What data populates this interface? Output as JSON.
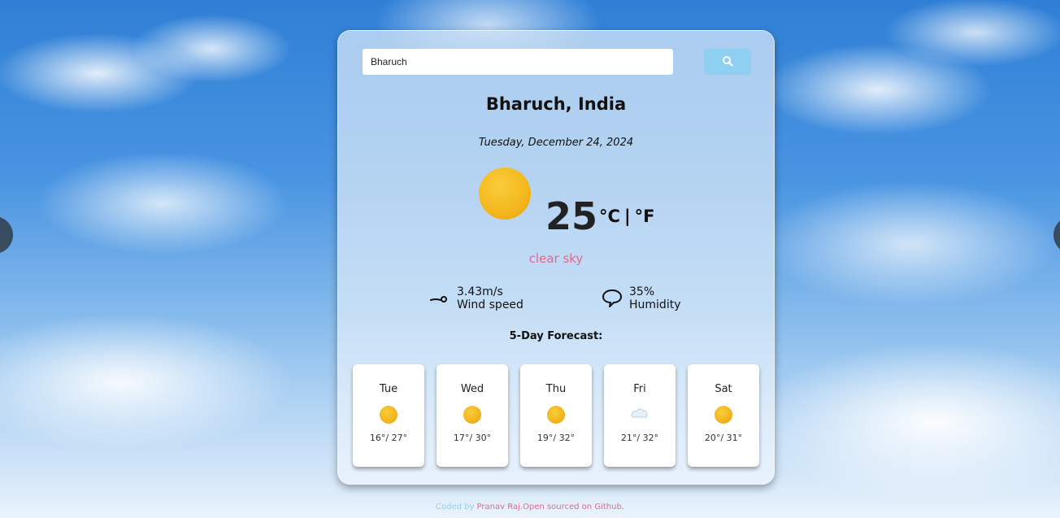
{
  "search": {
    "value": "Bharuch",
    "placeholder": ""
  },
  "location": {
    "city": "Bharuch, India",
    "date": "Tuesday, December 24, 2024"
  },
  "current": {
    "temperature": "25",
    "unit_c": "°C",
    "unit_sep": "|",
    "unit_f": "°F",
    "condition": "clear sky",
    "icon": "sun-icon"
  },
  "stats": {
    "wind": {
      "value": "3.43m/s",
      "label": "Wind speed",
      "icon": "wind-icon"
    },
    "humidity": {
      "value": "35%",
      "label": "Humidity",
      "icon": "humidity-icon"
    }
  },
  "forecast": {
    "title": "5-Day Forecast:",
    "days": [
      {
        "day": "Tue",
        "temps": "16°/ 27°",
        "icon": "sun-icon"
      },
      {
        "day": "Wed",
        "temps": "17°/ 30°",
        "icon": "sun-icon"
      },
      {
        "day": "Thu",
        "temps": "19°/ 32°",
        "icon": "sun-icon"
      },
      {
        "day": "Fri",
        "temps": "21°/ 32°",
        "icon": "cloud-icon"
      },
      {
        "day": "Sat",
        "temps": "20°/ 31°",
        "icon": "sun-icon"
      }
    ]
  },
  "footer": {
    "prefix": "Coded by ",
    "author_link": "Pranav Raj.",
    "repo_link": "Open sourced on Github."
  },
  "colors": {
    "accent": "#e2688e",
    "search_button": "#8fd0f2"
  }
}
